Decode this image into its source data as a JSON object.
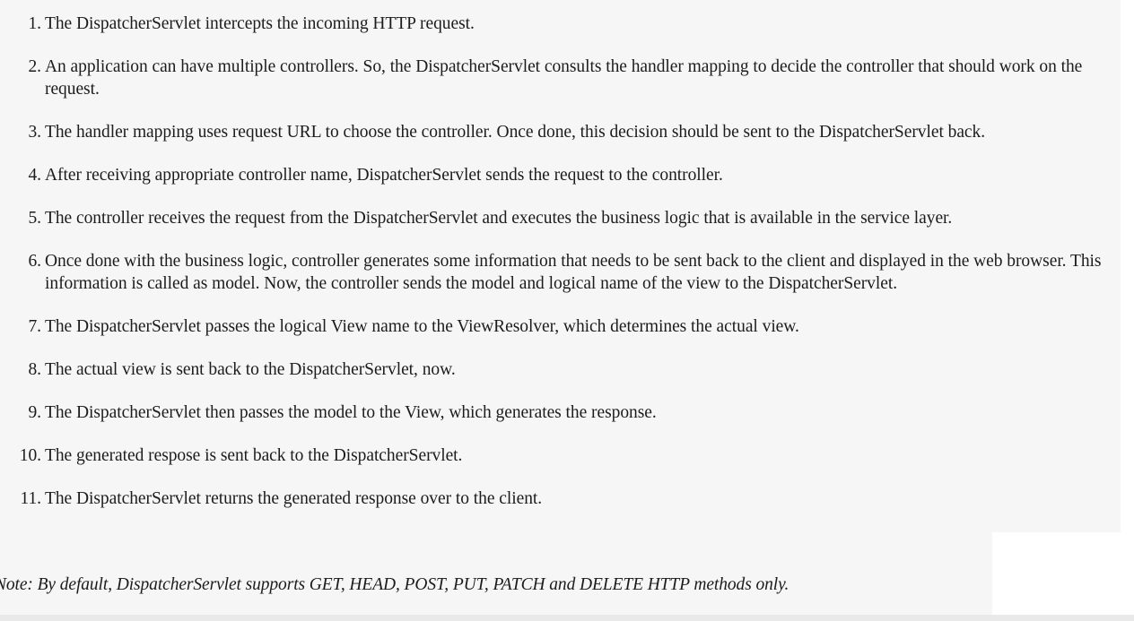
{
  "steps": [
    {
      "num": "1.",
      "text": "The DispatcherServlet intercepts the incoming HTTP request."
    },
    {
      "num": "2.",
      "text": "An application can have multiple controllers. So, the DispatcherServlet consults the handler mapping to decide the controller that should work on the request."
    },
    {
      "num": "3.",
      "text": "The handler mapping uses request URL to choose the controller. Once done, this decision should be sent to the DispatcherServlet back."
    },
    {
      "num": "4.",
      "text": "After receiving appropriate controller name, DispatcherServlet sends the request to the controller."
    },
    {
      "num": "5.",
      "text": "The controller receives the request from the DispatcherServlet and executes the business logic that is available in the service layer."
    },
    {
      "num": "6.",
      "text": "Once done with the business logic, controller generates some information that needs to be sent back to the client and displayed in the web browser. This information is called as model. Now, the controller sends the model and logical name of the view to the DispatcherServlet."
    },
    {
      "num": "7.",
      "text": "The DispatcherServlet passes the logical View name to the ViewResolver, which determines the actual view."
    },
    {
      "num": "8.",
      "text": "The actual view is sent back to the DispatcherServlet, now."
    },
    {
      "num": "9.",
      "text": "The DispatcherServlet then passes the model to the View, which generates the response."
    },
    {
      "num": "10.",
      "text": "The generated respose is sent back to the DispatcherServlet."
    },
    {
      "num": "11.",
      "text": "The DispatcherServlet returns the generated response over to the client."
    }
  ],
  "note": "Note: By default, DispatcherServlet supports GET, HEAD, POST, PUT, PATCH and DELETE HTTP methods only."
}
